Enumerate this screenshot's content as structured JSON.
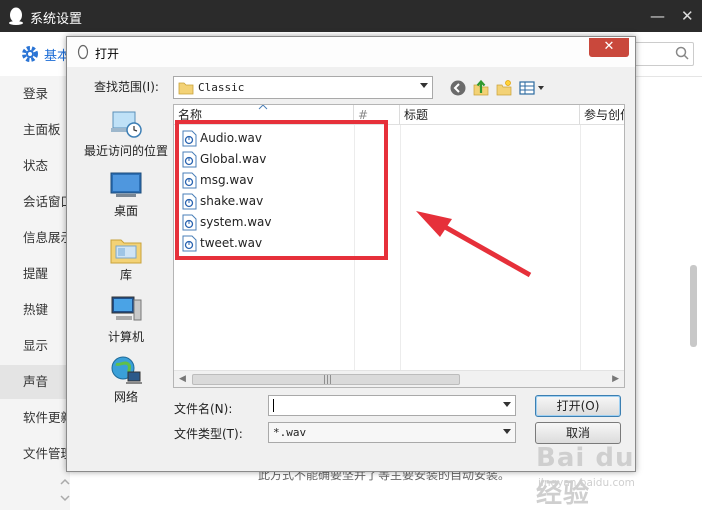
{
  "app": {
    "title": "系统设置",
    "tab_label": "基本",
    "close_glyph": "✕",
    "min_glyph": "—",
    "sidebar": [
      {
        "label": "登录"
      },
      {
        "label": "主面板"
      },
      {
        "label": "状态"
      },
      {
        "label": "会话窗口"
      },
      {
        "label": "信息展示"
      },
      {
        "label": "提醒"
      },
      {
        "label": "热键"
      },
      {
        "label": "显示"
      },
      {
        "label": "声音"
      },
      {
        "label": "软件更新"
      },
      {
        "label": "文件管理"
      }
    ],
    "bg_text": "此方式不能确要坚并了等主要安装的自动安装。"
  },
  "dialog": {
    "title": "打开",
    "close_glyph": "✕",
    "look_in_label": "查找范围(I):",
    "look_in_value": "Classic",
    "places": [
      {
        "label": "最近访问的位置",
        "icon": "recent-places-icon"
      },
      {
        "label": "桌面",
        "icon": "desktop-icon"
      },
      {
        "label": "库",
        "icon": "library-icon"
      },
      {
        "label": "计算机",
        "icon": "computer-icon"
      },
      {
        "label": "网络",
        "icon": "network-icon"
      }
    ],
    "columns": [
      {
        "label": "名称"
      },
      {
        "label": "#"
      },
      {
        "label": "标题"
      },
      {
        "label": "参与创作"
      }
    ],
    "files": [
      {
        "name": "Audio.wav"
      },
      {
        "name": "Global.wav"
      },
      {
        "name": "msg.wav"
      },
      {
        "name": "shake.wav"
      },
      {
        "name": "system.wav"
      },
      {
        "name": "tweet.wav"
      }
    ],
    "filename_label": "文件名(N):",
    "filename_value": "",
    "filetype_label": "文件类型(T):",
    "filetype_value": "*.wav",
    "open_button": "打开(O)",
    "cancel_button": "取消"
  },
  "watermark": {
    "brand": "Bai du 经验",
    "url": "jingyan.baidu.com"
  },
  "colors": {
    "highlight_red": "#e6303a",
    "title_bar": "#2b2b2b",
    "close_red": "#c9483c",
    "accent_blue": "#1c6cd6"
  }
}
